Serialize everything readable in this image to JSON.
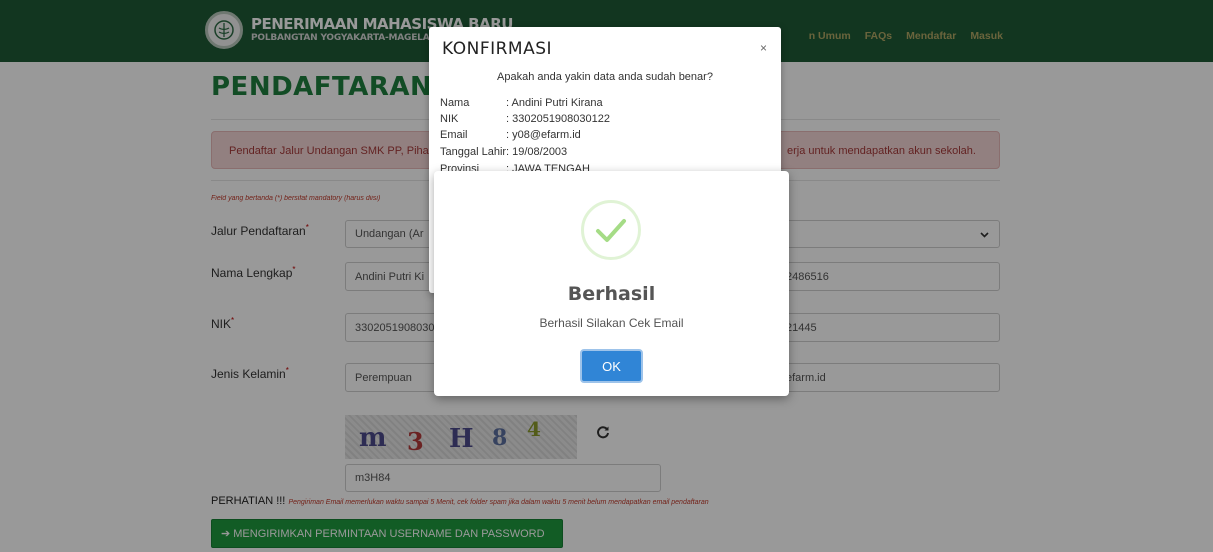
{
  "navbar": {
    "title": "PENERIMAAN MAHASISWA BARU",
    "subtitle": "POLBANGTAN YOGYAKARTA-MAGELANG",
    "menu": [
      "n Umum",
      "FAQs",
      "Mendaftar",
      "Masuk"
    ]
  },
  "page": {
    "title": "PENDAFTARAN AI",
    "alert_left": "Pendaftar Jalur Undangan SMK PP, Piha",
    "alert_right": "erja untuk mendapatkan akun sekolah.",
    "mandatory_note": "Field yang bertanda (*) bersifat mandatory (harus diisi)"
  },
  "form": {
    "jalur": {
      "label": "Jalur Pendaftaran",
      "value": "Undangan (Ar"
    },
    "nama": {
      "label": "Nama Lengkap",
      "value": "Andini Putri Ki"
    },
    "nik": {
      "label": "NIK",
      "value": "3302051908030"
    },
    "jenis_kelamin": {
      "label": "Jenis Kelamin",
      "value": "Perempuan"
    },
    "right_phone": "2486516",
    "right_wa": "21445",
    "right_email": "efarm.id",
    "captcha_chars": [
      "m",
      "3",
      "H",
      "8",
      "4"
    ],
    "captcha_input": "m3H84",
    "perhatian_label": "PERHATIAN !!!",
    "perhatian_note": "Pengiriman Email memerlukan waktu sampai 5 Menit, cek folder spam jika dalam waktu 5 menit belum mendapatkan email pendaftaran",
    "send_button": "➔ MENGIRIMKAN PERMINTAAN USERNAME DAN PASSWORD"
  },
  "confirm_modal": {
    "title": "KONFIRMASI",
    "close": "×",
    "question": "Apakah anda yakin data anda sudah benar?",
    "rows": [
      {
        "key": "Nama",
        "value": ": Andini Putri Kirana"
      },
      {
        "key": "NIK",
        "value": ": 3302051908030122"
      },
      {
        "key": "Email",
        "value": ": y08@efarm.id"
      },
      {
        "key": "Tanggal Lahir",
        "value": ": 19/08/2003"
      },
      {
        "key": "Provinsi",
        "value": ": JAWA TENGAH"
      }
    ]
  },
  "success_modal": {
    "title": "Berhasil",
    "message": "Berhasil Silakan Cek Email",
    "ok_label": "OK"
  },
  "colors": {
    "navbar": "#1e5b36",
    "title_green": "#1e7f3f",
    "ok_button": "#3085d6",
    "check_green": "#a5dc86"
  }
}
